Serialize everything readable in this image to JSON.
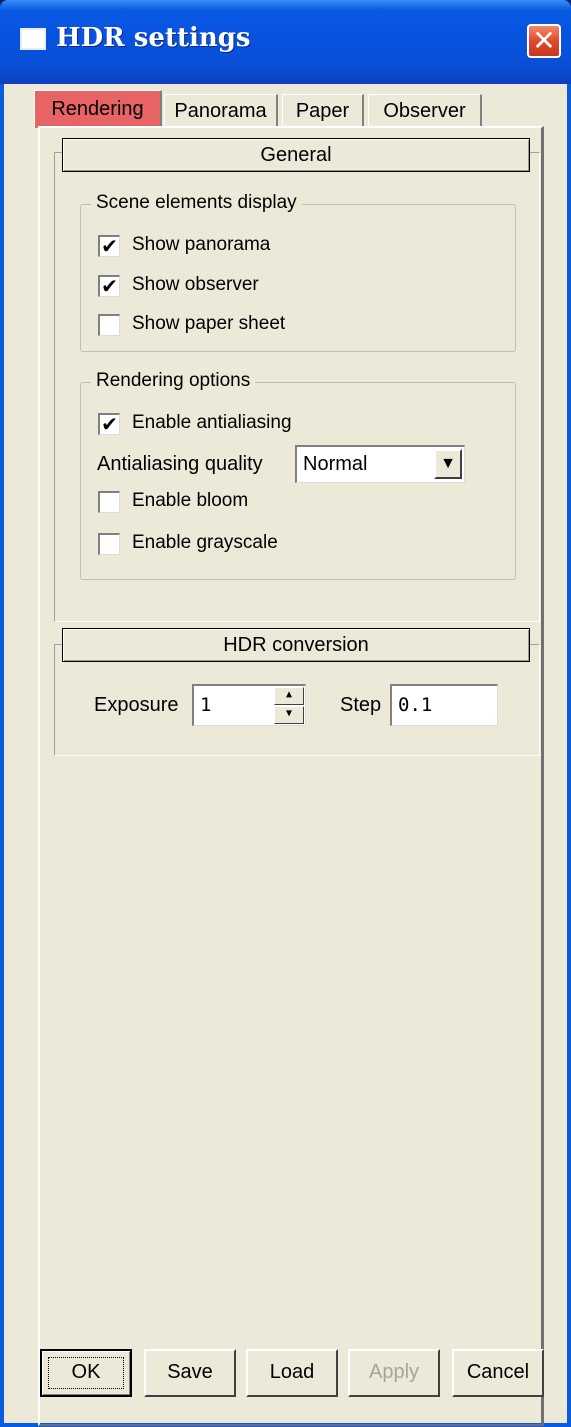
{
  "window": {
    "title": "HDR settings",
    "close_glyph": "✕"
  },
  "tabs": [
    {
      "label": "Rendering",
      "active": true
    },
    {
      "label": "Panorama",
      "active": false
    },
    {
      "label": "Paper",
      "active": false
    },
    {
      "label": "Observer",
      "active": false
    }
  ],
  "general": {
    "header": "General",
    "scene_display": {
      "legend": "Scene elements display",
      "show_panorama": {
        "label": "Show panorama",
        "checked": true,
        "mark": "✔"
      },
      "show_observer": {
        "label": "Show observer",
        "checked": true,
        "mark": "✔"
      },
      "show_paper_sheet": {
        "label": "Show paper sheet",
        "checked": false,
        "mark": ""
      }
    },
    "rendering_options": {
      "legend": "Rendering options",
      "enable_antialiasing": {
        "label": "Enable antialiasing",
        "checked": true,
        "mark": "✔"
      },
      "antialiasing_quality": {
        "label": "Antialiasing quality",
        "value": "Normal"
      },
      "enable_bloom": {
        "label": "Enable bloom",
        "checked": false,
        "mark": ""
      },
      "enable_grayscale": {
        "label": "Enable grayscale",
        "checked": false,
        "mark": ""
      }
    }
  },
  "hdr_conversion": {
    "header": "HDR conversion",
    "exposure": {
      "label": "Exposure",
      "value": "1"
    },
    "step": {
      "label": "Step",
      "value": "0.1"
    }
  },
  "buttons": {
    "ok": "OK",
    "save": "Save",
    "load": "Load",
    "apply": "Apply",
    "cancel": "Cancel"
  },
  "colors": {
    "titlebar": "#0753e0",
    "active_tab": "#e86464",
    "dialog_bg": "#ece9d8"
  }
}
